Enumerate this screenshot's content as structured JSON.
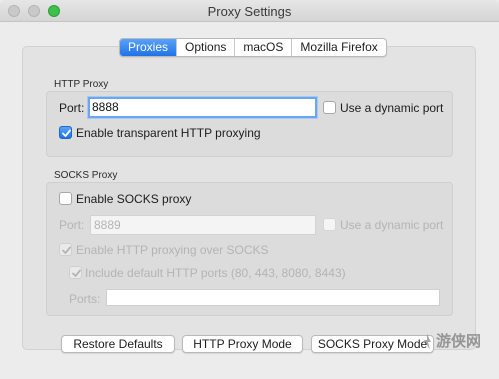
{
  "window": {
    "title": "Proxy Settings"
  },
  "tabs": [
    {
      "label": "Proxies",
      "active": true
    },
    {
      "label": "Options",
      "active": false
    },
    {
      "label": "macOS",
      "active": false
    },
    {
      "label": "Mozilla Firefox",
      "active": false
    }
  ],
  "http_proxy": {
    "title": "HTTP Proxy",
    "port_label": "Port:",
    "port_value": "8888",
    "dynamic_port_label": "Use a dynamic port",
    "dynamic_port_checked": false,
    "transparent_label": "Enable transparent HTTP proxying",
    "transparent_checked": true
  },
  "socks_proxy": {
    "title": "SOCKS Proxy",
    "enable_label": "Enable SOCKS proxy",
    "enable_checked": false,
    "port_label": "Port:",
    "port_placeholder": "8889",
    "dynamic_port_label": "Use a dynamic port",
    "http_over_socks_label": "Enable HTTP proxying over SOCKS",
    "http_over_socks_checked": true,
    "default_ports_label": "Include default HTTP ports (80, 443, 8080, 8443)",
    "default_ports_checked": true,
    "ports_label": "Ports:",
    "ports_value": ""
  },
  "buttons": {
    "restore": "Restore Defaults",
    "http_mode": "HTTP Proxy Mode",
    "socks_mode": "SOCKS Proxy Mode"
  },
  "watermark": {
    "text": "游侠网"
  },
  "colors": {
    "accent": "#1f73e8",
    "zoom_button": "#3fbf4b",
    "disabled_text": "#b4b4b4"
  }
}
